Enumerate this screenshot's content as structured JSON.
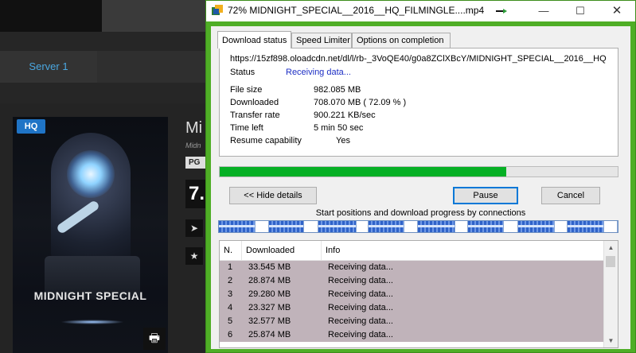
{
  "site": {
    "server_tab": "Server 1",
    "hq_badge": "HQ",
    "poster_title": "MIDNIGHT SPECIAL",
    "movie_title_partial": "Mi",
    "movie_sub_partial": "Midn",
    "rating_partial": "PG",
    "score_partial": "7."
  },
  "window": {
    "title": "72% MIDNIGHT_SPECIAL__2016__HQ_FILMINGLE....mp4",
    "minimize": "—",
    "maximize": "☐",
    "close": "✕"
  },
  "tabs": [
    {
      "label": "Download status",
      "active": true
    },
    {
      "label": "Speed Limiter",
      "active": false
    },
    {
      "label": "Options on completion",
      "active": false
    }
  ],
  "status": {
    "url": "https://15zf898.oloadcdn.net/dl/l/rb-_3VoQE40/g0a8ZClXBcY/MIDNIGHT_SPECIAL__2016__HQ",
    "status_label": "Status",
    "status_value": "Receiving data...",
    "file_size_label": "File size",
    "file_size_value": "982.085  MB",
    "downloaded_label": "Downloaded",
    "downloaded_value": "708.070  MB  ( 72.09 % )",
    "transfer_rate_label": "Transfer rate",
    "transfer_rate_value": "900.221  KB/sec",
    "time_left_label": "Time left",
    "time_left_value": "5 min 50 sec",
    "resume_label": "Resume capability",
    "resume_value": "Yes"
  },
  "progress": {
    "percent": 72.09,
    "fill_color": "#06b025"
  },
  "buttons": {
    "hide_details": "<< Hide details",
    "pause": "Pause",
    "cancel": "Cancel"
  },
  "connections_caption": "Start positions and download progress by connections",
  "connections_segments": [
    0.72,
    0.7,
    0.74,
    0.71,
    0.73,
    0.7,
    0.72,
    0.71
  ],
  "table": {
    "headers": [
      "N.",
      "Downloaded",
      "Info"
    ],
    "rows": [
      {
        "n": "1",
        "downloaded": "33.545  MB",
        "info": "Receiving data..."
      },
      {
        "n": "2",
        "downloaded": "28.874  MB",
        "info": "Receiving data..."
      },
      {
        "n": "3",
        "downloaded": "29.280  MB",
        "info": "Receiving data..."
      },
      {
        "n": "4",
        "downloaded": "23.327  MB",
        "info": "Receiving data..."
      },
      {
        "n": "5",
        "downloaded": "32.577  MB",
        "info": "Receiving data..."
      },
      {
        "n": "6",
        "downloaded": "25.874  MB",
        "info": "Receiving data..."
      }
    ]
  },
  "colors": {
    "window_border": "#4fae26",
    "status_value": "#1c2ec4",
    "list_row_bg": "#c0b3ba",
    "site_accent": "#4aa7e0"
  }
}
